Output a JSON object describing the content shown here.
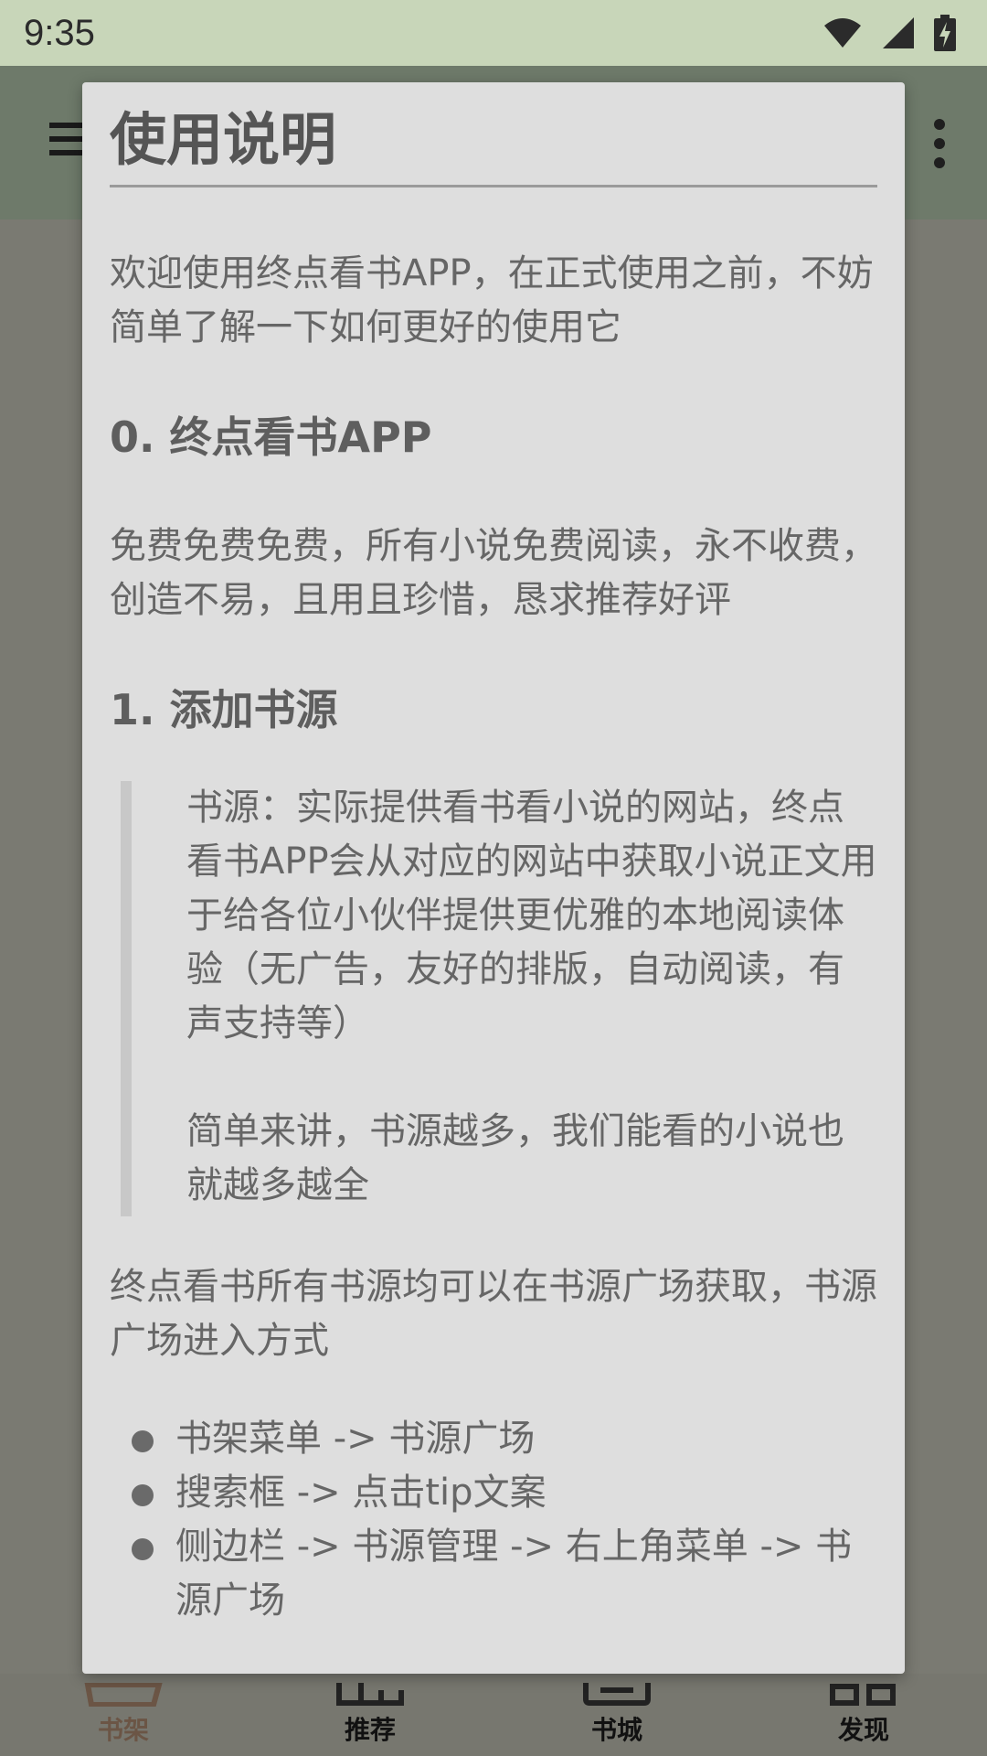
{
  "status_bar": {
    "time": "9:35",
    "icons": [
      "wifi-icon",
      "cellular-signal-icon",
      "battery-charging-icon"
    ]
  },
  "dialog": {
    "title": "使用说明",
    "intro": "欢迎使用终点看书APP，在正式使用之前，不妨简单了解一下如何更好的使用它",
    "section0_heading": "0. 终点看书APP",
    "section0_text": "免费免费免费，所有小说免费阅读，永不收费，创造不易，且用且珍惜，恳求推荐好评",
    "section1_heading": "1. 添加书源",
    "quote_p1": "书源：实际提供看书看小说的网站，终点看书APP会从对应的网站中获取小说正文用于给各位小伙伴提供更优雅的本地阅读体验（无广告，友好的排版，自动阅读，有声支持等）",
    "quote_p2": "简单来讲，书源越多，我们能看的小说也就越多越全",
    "after_quote": "终点看书所有书源均可以在书源广场获取，书源广场进入方式",
    "list_items": [
      "书架菜单 -> 书源广场",
      "搜索框 -> 点击tip文案",
      "侧边栏 -> 书源管理 -> 右上角菜单 -> 书源广场"
    ]
  },
  "bottom_nav": {
    "items": [
      {
        "label": "书架",
        "active": true
      },
      {
        "label": "推荐",
        "active": false
      },
      {
        "label": "书城",
        "active": false
      },
      {
        "label": "发现",
        "active": false
      }
    ]
  },
  "colors": {
    "status_bar_bg": "#c8d6b9",
    "dialog_bg": "#dedede",
    "active_tab": "#6b5545"
  }
}
